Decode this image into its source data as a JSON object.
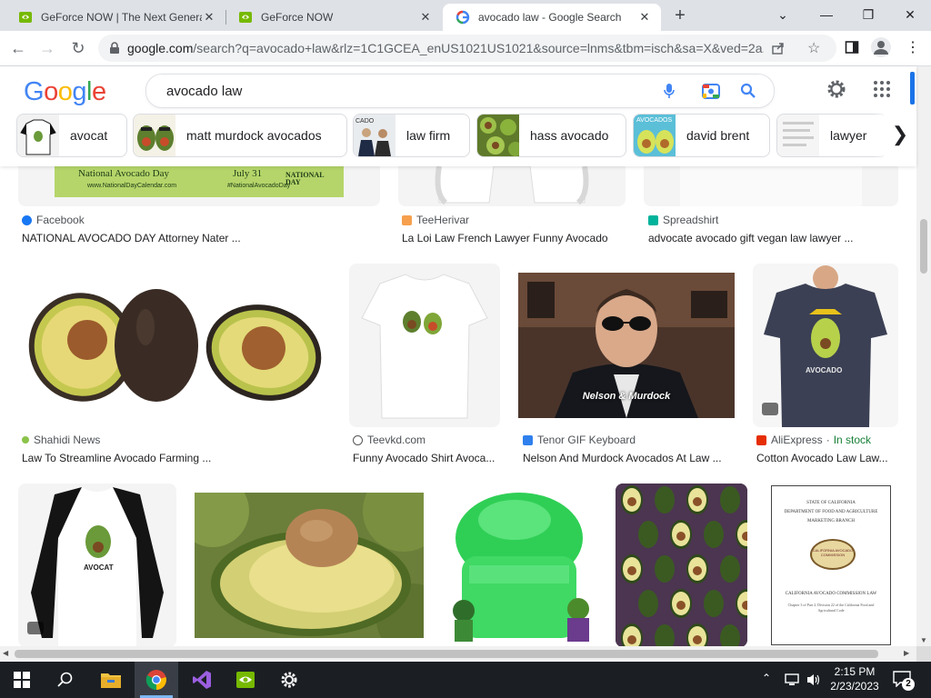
{
  "tabs": [
    {
      "title": "GeForce NOW | The Next Genera",
      "icon": "nvidia-icon",
      "active": false
    },
    {
      "title": "GeForce NOW",
      "icon": "nvidia-icon",
      "active": false
    },
    {
      "title": "avocado law - Google Search",
      "icon": "google-icon",
      "active": true
    }
  ],
  "new_tab_label": "+",
  "address": {
    "host": "google.com",
    "path": "/search?q=avocado+law&rlz=1C1GCEA_enUS1021US1021&source=lnms&tbm=isch&sa=X&ved=2a..."
  },
  "search": {
    "query": "avocado law"
  },
  "chips": [
    {
      "label": "avocat"
    },
    {
      "label": "matt murdock avocados"
    },
    {
      "label": "law firm"
    },
    {
      "label": "hass avocado"
    },
    {
      "label": "david brent"
    },
    {
      "label": "lawyer"
    }
  ],
  "row0": [
    {
      "source": "Facebook",
      "caption": "NATIONAL AVOCADO DAY Attorney Nater ..."
    },
    {
      "source": "TeeHerivar",
      "caption": "La Loi Law French Lawyer Funny Avocado"
    },
    {
      "source": "Spreadshirt",
      "caption": "advocate avocado gift vegan law lawyer ..."
    }
  ],
  "banner": {
    "title": "National Avocado Day",
    "date": "July 31",
    "site": "www.NationalDayCalendar.com",
    "hashtag": "#NationalAvocadoDay",
    "badge": "NATIONAL DAY"
  },
  "row1": [
    {
      "source": "Shahidi News",
      "caption": "Law To Streamline Avocado Farming ..."
    },
    {
      "source": "Teevkd.com",
      "caption": "Funny Avocado Shirt Avoca..."
    },
    {
      "source": "Tenor GIF Keyboard",
      "caption": "Nelson And Murdock Avocados At Law ..."
    },
    {
      "source": "AliExpress",
      "stock": "In stock",
      "caption": "Cotton Avocado Law Law..."
    }
  ],
  "gif_overlay": "Nelson & Murdock",
  "shirt_text": "AVOCADO",
  "raglan_text": "AVOCAT",
  "doc": {
    "line1": "STATE OF CALIFORNIA",
    "line2": "DEPARTMENT OF FOOD AND AGRICULTURE",
    "line3": "MARKETING BRANCH",
    "seal": "CALIFORNIA AVOCADO COMMISSION",
    "title": "CALIFORNIA AVOCADO COMMISSION LAW",
    "sub": "Chapter 3 of Part 2, Division 22 of the California Food and Agricultural Code"
  },
  "taskbar": {
    "time": "2:15 PM",
    "date": "2/23/2023",
    "notif_count": "2"
  },
  "colors": {
    "google_blue": "#4285f4",
    "google_red": "#ea4335",
    "google_yellow": "#fbbc05",
    "google_green": "#34a853",
    "nvidia": "#76b900",
    "taskbar": "#1b1f24"
  }
}
